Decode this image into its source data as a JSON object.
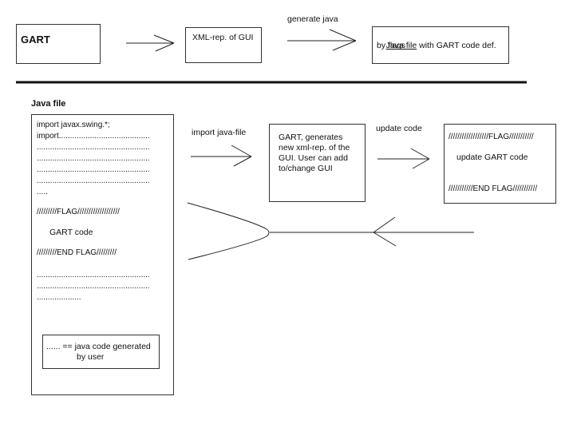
{
  "top_flow": {
    "gart_box": {
      "label": "GART"
    },
    "xml_box": {
      "label": "XML-rep. of GUI"
    },
    "generate_label": "generate java",
    "java_box": {
      "link_text": "Java file",
      "rest_line1": " with GART code def.",
      "line2": "by flags"
    }
  },
  "java_file": {
    "title": "Java file",
    "lines": [
      "import javax.swing.*;",
      "import.........................................",
      "...................................................",
      "...................................................",
      "...................................................",
      "...................................................",
      "....."
    ],
    "flag_start": "/////////FLAG///////////////////",
    "gart_code": "GART code",
    "flag_end": "/////////END FLAG/////////",
    "trailing_lines": [
      "...................................................",
      "...................................................",
      "...................."
    ],
    "legend": {
      "line1": "...... == java code generated",
      "line2": "by user"
    }
  },
  "middle_flow": {
    "import_label": "import java-file",
    "gart_box": {
      "lines": [
        "GART, generates",
        "new xml-rep. of the",
        "GUI. User can add",
        "to/change GUI"
      ]
    },
    "update_label": "update code",
    "update_box": {
      "flag_start": "//////////////////FLAG///////////",
      "body": "update GART code",
      "flag_end": "///////////END FLAG///////////"
    }
  }
}
